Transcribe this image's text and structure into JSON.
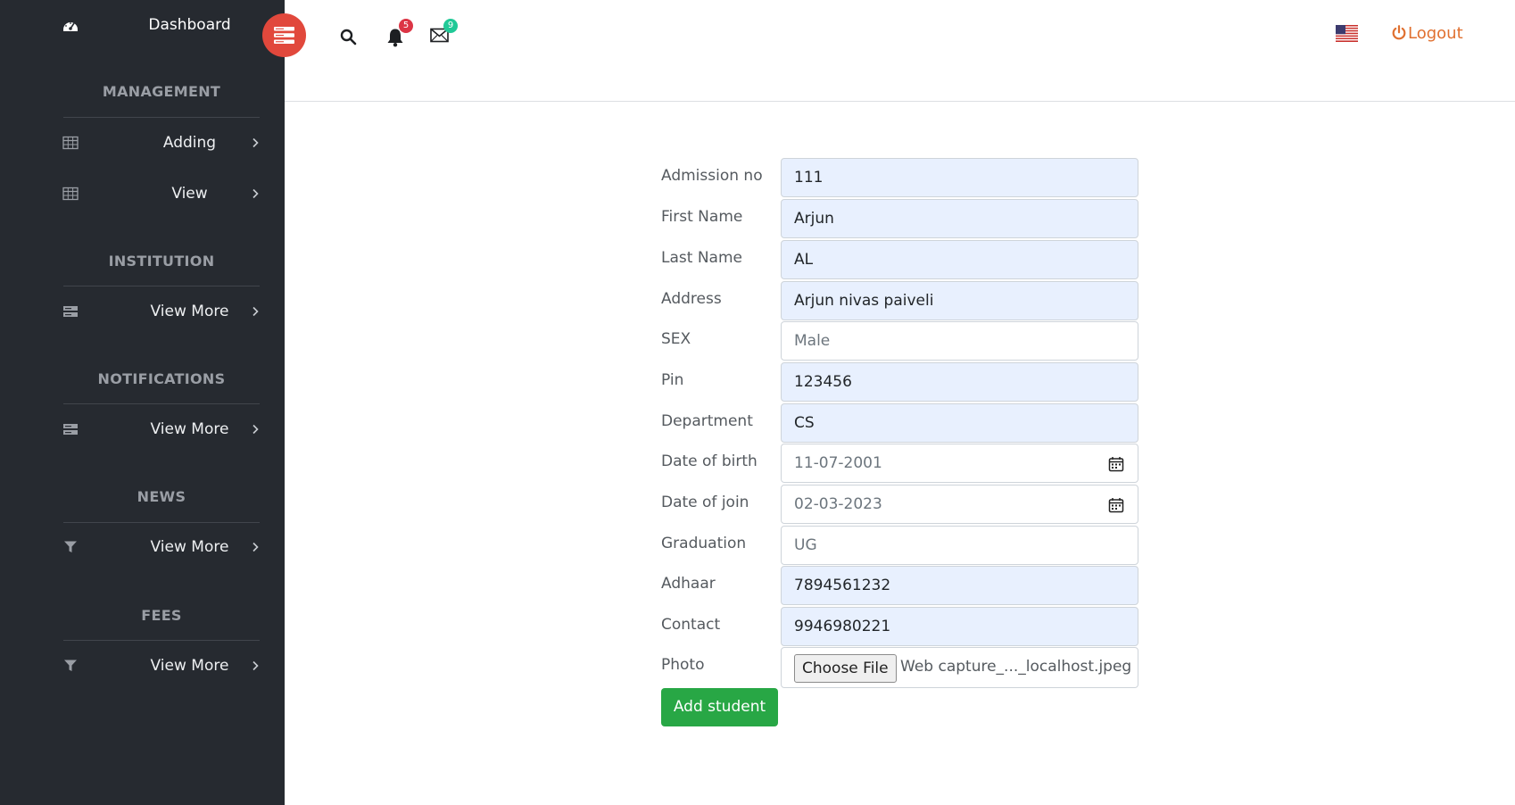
{
  "sidebar": {
    "dashboard_label": "Dashboard",
    "sections": [
      {
        "title": "MANAGEMENT",
        "items": [
          {
            "label": "Adding",
            "icon": "table-icon"
          },
          {
            "label": "View",
            "icon": "table-icon"
          }
        ]
      },
      {
        "title": "INSTITUTION",
        "items": [
          {
            "label": "View More",
            "icon": "server-icon"
          }
        ]
      },
      {
        "title": "NOTIFICATIONS",
        "items": [
          {
            "label": "View More",
            "icon": "server-icon"
          }
        ]
      },
      {
        "title": "NEWS",
        "items": [
          {
            "label": "View More",
            "icon": "filter-icon"
          }
        ]
      },
      {
        "title": "FEES",
        "items": [
          {
            "label": "View More",
            "icon": "filter-icon"
          }
        ]
      }
    ]
  },
  "topbar": {
    "notification_count": "5",
    "message_count": "9",
    "logout_label": "Logout",
    "colors": {
      "toggle": "#e1483c",
      "notification_badge": "#dc3545",
      "message_badge": "#20c997",
      "logout": "#e07030"
    }
  },
  "form": {
    "fields": [
      {
        "label": "Admission no",
        "value": "111",
        "autofilled": true
      },
      {
        "label": "First Name",
        "value": "Arjun",
        "autofilled": true
      },
      {
        "label": "Last Name",
        "value": "AL",
        "autofilled": true
      },
      {
        "label": "Address",
        "value": "Arjun nivas paiveli",
        "autofilled": true
      },
      {
        "label": "SEX",
        "placeholder": "Male"
      },
      {
        "label": "Pin",
        "value": "123456",
        "autofilled": true
      },
      {
        "label": "Department",
        "value": "CS",
        "autofilled": true
      },
      {
        "label": "Date of birth",
        "value": "11-07-2001",
        "type": "date"
      },
      {
        "label": "Date of join",
        "value": "02-03-2023",
        "type": "date"
      },
      {
        "label": "Graduation",
        "placeholder": "UG"
      },
      {
        "label": "Adhaar",
        "value": "7894561232",
        "autofilled": true
      },
      {
        "label": "Contact",
        "value": "9946980221",
        "autofilled": true
      }
    ],
    "photo": {
      "label": "Photo",
      "button_label": "Choose File",
      "file_name": "Web capture_..._localhost.jpeg"
    },
    "submit_label": "Add student",
    "submit_color": "#28a745"
  }
}
